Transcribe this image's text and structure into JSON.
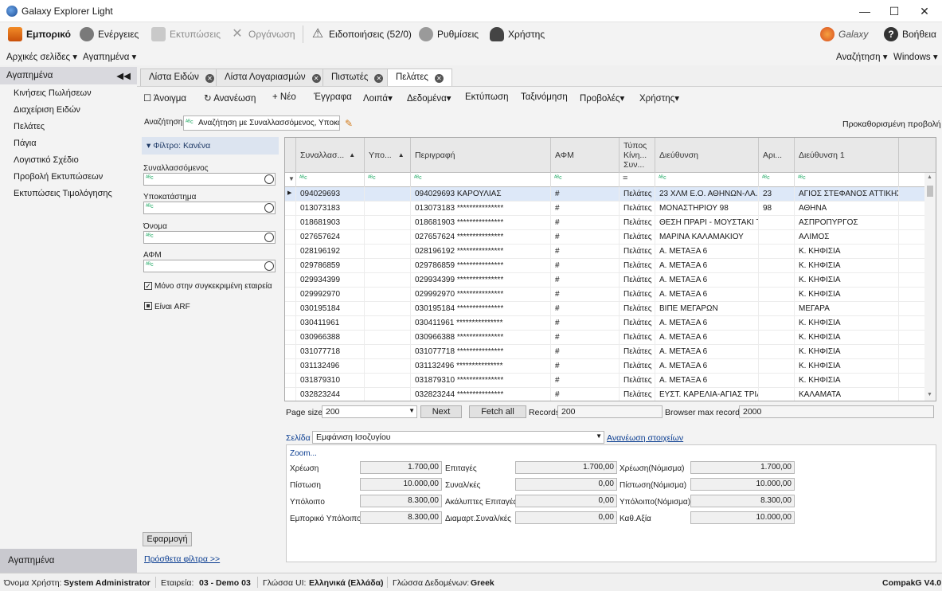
{
  "window": {
    "title": "Galaxy Explorer Light",
    "minimize": "—",
    "maximize": "☐",
    "close": "✕"
  },
  "ribbon": {
    "commercial": "Εμπορικό",
    "actions": "Ενέργειες",
    "prints": "Εκτυπώσεις",
    "organization": "Οργάνωση",
    "notifications": "Ειδοποιήσεις (52/0)",
    "settings": "Ρυθμίσεις",
    "user": "Χρήστης",
    "help": "Βοήθεια",
    "brand": "Galaxy"
  },
  "menubar": {
    "home": "Αρχικές σελίδες",
    "favorites": "Αγαπημένα",
    "search": "Αναζήτηση",
    "windows": "Windows"
  },
  "sidebar": {
    "header": "Αγαπημένα",
    "items": [
      "Κινήσεις Πωλήσεων",
      "Διαχείριση Ειδών",
      "Πελάτες",
      "Πάγια",
      "Λογιστικό Σχέδιο",
      "Προβολή Εκτυπώσεων",
      "Εκτυπώσεις Τιμολόγησης"
    ],
    "footer": "Αγαπημένα"
  },
  "tabs": [
    "Λίστα Ειδών",
    "Λίστα Λογαριασμών",
    "Πιστωτές",
    "Πελάτες"
  ],
  "toolbar": {
    "open": "Άνοιγμα",
    "refresh": "Ανανέωση",
    "new": "Νέο",
    "documents": "Έγγραφα",
    "other": "Λοιπά",
    "data": "Δεδομένα",
    "print": "Εκτύπωση",
    "sort": "Ταξινόμηση",
    "views": "Προβολές",
    "user": "Χρήστης"
  },
  "search": {
    "label": "Αναζήτηση",
    "value": "Αναζήτηση με Συναλλασσόμενος, Υποκατ",
    "default_view": "Προκαθορισμένη προβολή"
  },
  "filters": {
    "header": "Φίλτρο: Κανένα",
    "fields": [
      "Συναλλασσόμενος",
      "Υποκατάστημα",
      "Όνομα",
      "ΑΦΜ"
    ],
    "only_company": "Μόνο στην συγκεκριμένη εταιρεία",
    "is_arf": "Είναι ARF",
    "apply": "Εφαρμογή",
    "more": "Πρόσθετα φίλτρα >>"
  },
  "grid": {
    "columns": [
      "Συναλλασ...",
      "Υπο...",
      "Περιγραφή",
      "ΑΦΜ",
      "Τύπος Κίνη... Συν...",
      "Διεύθυνση",
      "Αρι...",
      "Διεύθυνση 1"
    ],
    "filter_glyphs": {
      "text": "ᴬᴮc",
      "equals": "="
    },
    "rows": [
      [
        "094029693",
        "",
        "094029693 ΚΑΡΟΥΛΙΑΣ",
        "#",
        "Πελάτες",
        "23 ΧΛΜ Ε.Ο. ΑΘΗΝΩΝ-ΛΑ...",
        "23",
        "ΑΓΙΟΣ ΣΤΕΦΑΝΟΣ ΑΤΤΙΚΗΣ"
      ],
      [
        "013073183",
        "",
        "013073183 ***************",
        "#",
        "Πελάτες",
        "ΜΟΝΑΣΤΗΡΙΟΥ 98",
        "98",
        "ΑΘΗΝΑ"
      ],
      [
        "018681903",
        "",
        "018681903 ***************",
        "#",
        "Πελάτες",
        "ΘΕΣΗ ΠΡΑΡΙ - ΜΟΥΣΤΑΚΙ ΤΘ",
        "",
        "ΑΣΠΡΟΠΥΡΓΟΣ"
      ],
      [
        "027657624",
        "",
        "027657624 ***************",
        "#",
        "Πελάτες",
        "ΜΑΡΙΝΑ ΚΑΛΑΜΑΚΙΟΥ",
        "",
        "ΑΛΙΜΟΣ"
      ],
      [
        "028196192",
        "",
        "028196192 ***************",
        "#",
        "Πελάτες",
        "Α.  ΜΕΤΑΞΑ 6",
        "",
        "Κ. ΚΗΦΙΣΙΑ"
      ],
      [
        "029786859",
        "",
        "029786859 ***************",
        "#",
        "Πελάτες",
        "Α.  ΜΕΤΑΞΑ 6",
        "",
        "Κ. ΚΗΦΙΣΙΑ"
      ],
      [
        "029934399",
        "",
        "029934399 ***************",
        "#",
        "Πελάτες",
        "Α.  ΜΕΤΑΞΑ 6",
        "",
        "Κ. ΚΗΦΙΣΙΑ"
      ],
      [
        "029992970",
        "",
        "029992970 ***************",
        "#",
        "Πελάτες",
        "Α.  ΜΕΤΑΞΑ 6",
        "",
        "Κ. ΚΗΦΙΣΙΑ"
      ],
      [
        "030195184",
        "",
        "030195184 ***************",
        "#",
        "Πελάτες",
        "ΒΙΠΕ ΜΕΓΑΡΩΝ",
        "",
        "ΜΕΓΑΡΑ"
      ],
      [
        "030411961",
        "",
        "030411961 ***************",
        "#",
        "Πελάτες",
        "Α.  ΜΕΤΑΞΑ 6",
        "",
        "Κ. ΚΗΦΙΣΙΑ"
      ],
      [
        "030966388",
        "",
        "030966388 ***************",
        "#",
        "Πελάτες",
        "Α.  ΜΕΤΑΞΑ 6",
        "",
        "Κ. ΚΗΦΙΣΙΑ"
      ],
      [
        "031077718",
        "",
        "031077718 ***************",
        "#",
        "Πελάτες",
        "Α.  ΜΕΤΑΞΑ 6",
        "",
        "Κ. ΚΗΦΙΣΙΑ"
      ],
      [
        "031132496",
        "",
        "031132496 ***************",
        "#",
        "Πελάτες",
        "Α.  ΜΕΤΑΞΑ 6",
        "",
        "Κ. ΚΗΦΙΣΙΑ"
      ],
      [
        "031879310",
        "",
        "031879310 ***************",
        "#",
        "Πελάτες",
        "Α.  ΜΕΤΑΞΑ 6",
        "",
        "Κ. ΚΗΦΙΣΙΑ"
      ],
      [
        "032823244",
        "",
        "032823244 ***************",
        "#",
        "Πελάτες",
        "ΕΥΣΤ. ΚΑΡΕΛΙΑ-ΑΓΙΑΣ ΤΡΙΑ...",
        "",
        "ΚΑΛΑΜΑΤΑ"
      ]
    ]
  },
  "pager": {
    "page_size_label": "Page size",
    "page_size": "200",
    "next": "Next",
    "fetch_all": "Fetch all",
    "records_label": "Records",
    "records": "200",
    "browser_max_label": "Browser max records",
    "browser_max": "2000"
  },
  "page_select": {
    "label": "Σελίδα",
    "value": "Εμφάνιση Ισοζυγίου",
    "refresh_link": "Ανανέωση στοιχείων"
  },
  "summary": {
    "zoom": "Zoom...",
    "col1": [
      {
        "label": "Χρέωση",
        "value": "1.700,00"
      },
      {
        "label": "Πίστωση",
        "value": "10.000,00"
      },
      {
        "label": "Υπόλοιπο",
        "value": "8.300,00"
      },
      {
        "label": "Εμπορικό Υπόλοιπο",
        "value": "8.300,00"
      }
    ],
    "col2": [
      {
        "label": "Επιταγές",
        "value": "1.700,00"
      },
      {
        "label": "Συναλ/κές",
        "value": "0,00"
      },
      {
        "label": "Ακάλυπτες Επιταγές",
        "value": "0,00"
      },
      {
        "label": "Διαμαρτ.Συναλ/κές",
        "value": "0,00"
      }
    ],
    "col3": [
      {
        "label": "Χρέωση(Νόμισμα)",
        "value": "1.700,00"
      },
      {
        "label": "Πίστωση(Νόμισμα)",
        "value": "10.000,00"
      },
      {
        "label": "Υπόλοιπο(Νόμισμα)",
        "value": "8.300,00"
      },
      {
        "label": "Καθ.Αξία",
        "value": "10.000,00"
      }
    ]
  },
  "status": {
    "user_label": "Όνομα Χρήστη:",
    "user": "System Administrator",
    "company_label": "Εταιρεία:",
    "company": "03 - Demo 03",
    "ui_lang_label": "Γλώσσα UI:",
    "ui_lang": "Ελληνικά (Ελλάδα)",
    "data_lang_label": "Γλώσσα Δεδομένων:",
    "data_lang": "Greek",
    "version": "CompakG V4.0"
  },
  "colors": {
    "accent": "#0a3d91",
    "selected_row": "#dde8f8",
    "header": "#e8e8e8"
  }
}
